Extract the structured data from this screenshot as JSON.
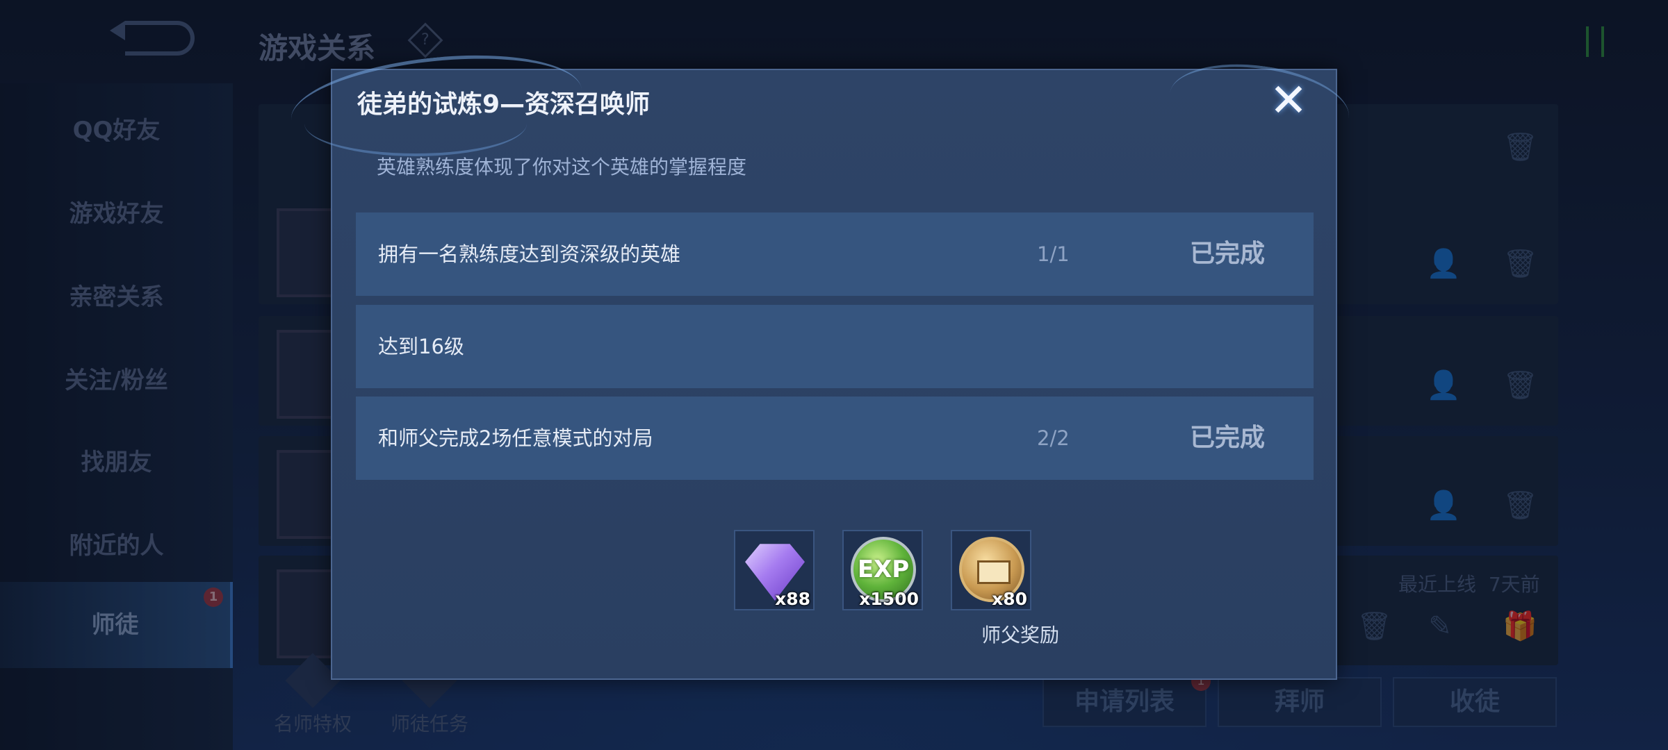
{
  "background": {
    "title": "游戏关系",
    "sidebar": [
      {
        "label": "QQ好友"
      },
      {
        "label": "游戏好友"
      },
      {
        "label": "亲密关系"
      },
      {
        "label": "关注/粉丝"
      },
      {
        "label": "找朋友"
      },
      {
        "label": "附近的人"
      },
      {
        "label": "师徒",
        "active": true,
        "badge": "1"
      }
    ],
    "last_online_label": "最近上线",
    "last_online_value": "7天前",
    "bottom_tabs": [
      {
        "label": "名师特权"
      },
      {
        "label": "师徒任务"
      }
    ],
    "bottom_buttons": [
      {
        "label": "申请列表",
        "badge": "1"
      },
      {
        "label": "拜师"
      },
      {
        "label": "收徒"
      }
    ]
  },
  "dialog": {
    "title": "徒弟的试炼9—资深召唤师",
    "description": "英雄熟练度体现了你对这个英雄的掌握程度",
    "tasks": [
      {
        "text": "拥有一名熟练度达到资深级的英雄",
        "progress": "1/1",
        "status": "已完成"
      },
      {
        "text": "达到16级",
        "progress": "",
        "status": ""
      },
      {
        "text": "和师父完成2场任意模式的对局",
        "progress": "2/2",
        "status": "已完成"
      }
    ],
    "rewards": [
      {
        "icon": "purple-gem-icon",
        "count": "x88"
      },
      {
        "icon": "exp-orb-icon",
        "label_on_icon": "EXP",
        "count": "x1500"
      },
      {
        "icon": "master-medal-icon",
        "count": "x80"
      }
    ],
    "reward_label": "师父奖励",
    "close_symbol": "✕"
  }
}
